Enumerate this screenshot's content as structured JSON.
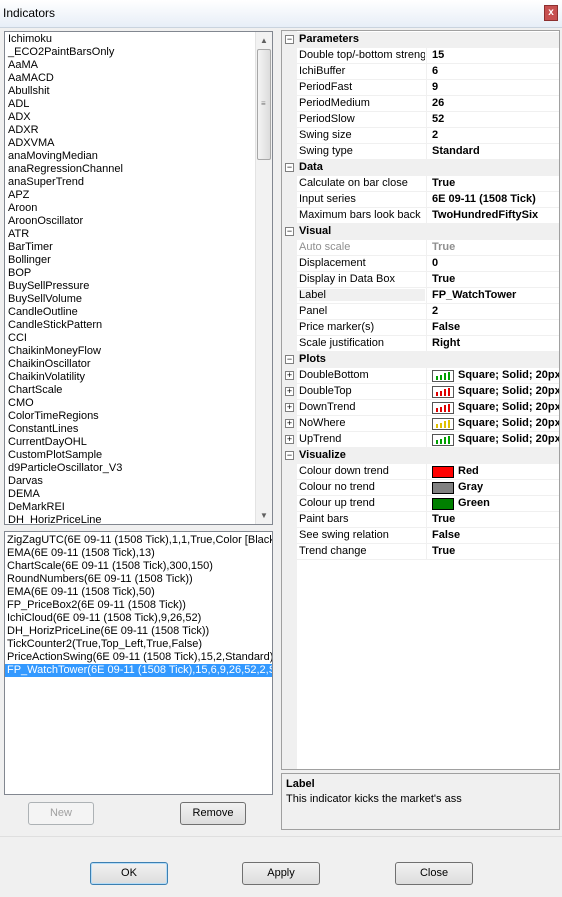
{
  "window": {
    "title": "Indicators",
    "close_glyph": "x"
  },
  "indicator_list": [
    "Ichimoku",
    "_ECO2PaintBarsOnly",
    "AaMA",
    "AaMACD",
    "Abullshit",
    "ADL",
    "ADX",
    "ADXR",
    "ADXVMA",
    "anaMovingMedian",
    "anaRegressionChannel",
    "anaSuperTrend",
    "APZ",
    "Aroon",
    "AroonOscillator",
    "ATR",
    "BarTimer",
    "Bollinger",
    "BOP",
    "BuySellPressure",
    "BuySellVolume",
    "CandleOutline",
    "CandleStickPattern",
    "CCI",
    "ChaikinMoneyFlow",
    "ChaikinOscillator",
    "ChaikinVolatility",
    "ChartScale",
    "CMO",
    "ColorTimeRegions",
    "ConstantLines",
    "CurrentDayOHL",
    "CustomPlotSample",
    "d9ParticleOscillator_V3",
    "Darvas",
    "DEMA",
    "DeMarkREI",
    "DH_HorizPriceLine"
  ],
  "applied_list": [
    "ZigZagUTC(6E 09-11 (1508 Tick),1,1,True,Color [Black]",
    "EMA(6E 09-11 (1508 Tick),13)",
    "ChartScale(6E 09-11 (1508 Tick),300,150)",
    "RoundNumbers(6E 09-11 (1508 Tick))",
    "EMA(6E 09-11 (1508 Tick),50)",
    "FP_PriceBox2(6E 09-11 (1508 Tick))",
    "IchiCloud(6E 09-11 (1508 Tick),9,26,52)",
    "DH_HorizPriceLine(6E 09-11 (1508 Tick))",
    "TickCounter2(True,Top_Left,True,False)",
    "PriceActionSwing(6E 09-11 (1508 Tick),15,2,Standard)",
    "FP_WatchTower(6E 09-11 (1508 Tick),15,6,9,26,52,2,S"
  ],
  "buttons": {
    "new": "New",
    "remove": "Remove",
    "ok": "OK",
    "apply": "Apply",
    "close": "Close"
  },
  "grid": {
    "collapse_glyph": "−",
    "expand_glyph": "+",
    "parameters": {
      "title": "Parameters",
      "rows": [
        {
          "label": "Double top/-bottom strength",
          "value": "15"
        },
        {
          "label": "IchiBuffer",
          "value": "6"
        },
        {
          "label": "PeriodFast",
          "value": "9"
        },
        {
          "label": "PeriodMedium",
          "value": "26"
        },
        {
          "label": "PeriodSlow",
          "value": "52"
        },
        {
          "label": "Swing size",
          "value": "2"
        },
        {
          "label": "Swing type",
          "value": "Standard"
        }
      ]
    },
    "data": {
      "title": "Data",
      "rows": [
        {
          "label": "Calculate on bar close",
          "value": "True"
        },
        {
          "label": "Input series",
          "value": "6E 09-11 (1508 Tick)"
        },
        {
          "label": "Maximum bars look back",
          "value": "TwoHundredFiftySix"
        }
      ]
    },
    "visual": {
      "title": "Visual",
      "rows": [
        {
          "label": "Auto scale",
          "value": "True"
        },
        {
          "label": "Displacement",
          "value": "0"
        },
        {
          "label": "Display in Data Box",
          "value": "True"
        },
        {
          "label": "Label",
          "value": "FP_WatchTower"
        },
        {
          "label": "Panel",
          "value": "2"
        },
        {
          "label": "Price marker(s)",
          "value": "False"
        },
        {
          "label": "Scale justification",
          "value": "Right"
        }
      ]
    },
    "plots": {
      "title": "Plots",
      "rows": [
        {
          "label": "DoubleBottom",
          "value": "Square; Solid; 20px",
          "color": "#00a000"
        },
        {
          "label": "DoubleTop",
          "value": "Square; Solid; 20px",
          "color": "#e00000"
        },
        {
          "label": "DownTrend",
          "value": "Square; Solid; 20px",
          "color": "#e00000"
        },
        {
          "label": "NoWhere",
          "value": "Square; Solid; 20px",
          "color": "#e0c000"
        },
        {
          "label": "UpTrend",
          "value": "Square; Solid; 20px",
          "color": "#00a000"
        }
      ]
    },
    "visualize": {
      "title": "Visualize",
      "rows": [
        {
          "label": "Colour down trend",
          "value": "Red",
          "swatch": "#ff0000"
        },
        {
          "label": "Colour no trend",
          "value": "Gray",
          "swatch": "#808080"
        },
        {
          "label": "Colour up trend",
          "value": "Green",
          "swatch": "#008000"
        },
        {
          "label": "Paint bars",
          "value": "True"
        },
        {
          "label": "See swing relation",
          "value": "False"
        },
        {
          "label": "Trend change",
          "value": "True"
        }
      ]
    }
  },
  "description": {
    "title": "Label",
    "text": "This indicator kicks the market's ass"
  }
}
